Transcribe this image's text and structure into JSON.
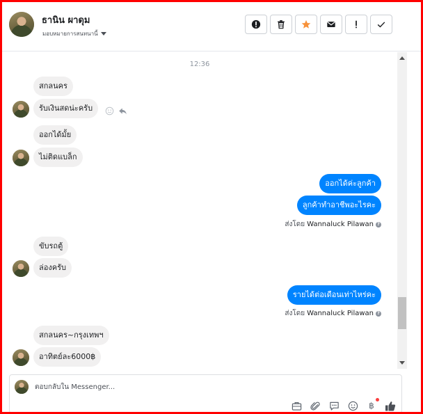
{
  "header": {
    "contact_name": "ธานิน ผาดุม",
    "assign_label": "มอบหมายการสนทนานี้",
    "avatar_icon": "user-avatar",
    "actions": [
      {
        "name": "spam-button",
        "icon": "exclamation-circle-icon"
      },
      {
        "name": "delete-button",
        "icon": "trash-icon"
      },
      {
        "name": "star-button",
        "icon": "star-icon",
        "color": "#f7923b"
      },
      {
        "name": "mark-unread-button",
        "icon": "envelope-icon"
      },
      {
        "name": "follow-up-button",
        "icon": "exclamation-icon"
      },
      {
        "name": "mark-done-button",
        "icon": "check-icon"
      }
    ]
  },
  "conversation": {
    "timestamp": "12:36",
    "messages": [
      {
        "dir": "in",
        "text": "สกลนคร"
      },
      {
        "dir": "in",
        "text": "รับเงินสดน่ะครับ"
      },
      {
        "dir": "in",
        "text": "ออกได้มั้ย"
      },
      {
        "dir": "in",
        "text": "ไม่ติดแบล็ก"
      },
      {
        "dir": "out",
        "text": "ออกได้ค่ะลูกค้า"
      },
      {
        "dir": "out",
        "text": "ลูกค้าทำอาชีพอะไรคะ"
      },
      {
        "dir": "in",
        "text": "ขับรถตู้"
      },
      {
        "dir": "in",
        "text": "ล่องครับ"
      },
      {
        "dir": "out",
        "text": "รายได้ต่อเดือนเท่าไหร่คะ"
      },
      {
        "dir": "in",
        "text": "สกลนคร~กรุงเทพฯ"
      },
      {
        "dir": "in",
        "text": "อาทิตย์ละ6000฿"
      }
    ],
    "sent_by_prefix": "ส่งโดย",
    "sent_by_agent": "Wannaluck Pilawan"
  },
  "reply": {
    "placeholder": "ตอบกลับใน Messenger...",
    "tools": [
      "briefcase-icon",
      "paperclip-icon",
      "saved-reply-icon",
      "emoji-icon",
      "baht-payment-icon",
      "thumbs-up-icon"
    ],
    "baht_symbol": "฿"
  },
  "colors": {
    "outgoing_bubble": "#0084ff",
    "incoming_bubble": "#f1f0f0",
    "frame_border": "#ff0000"
  }
}
